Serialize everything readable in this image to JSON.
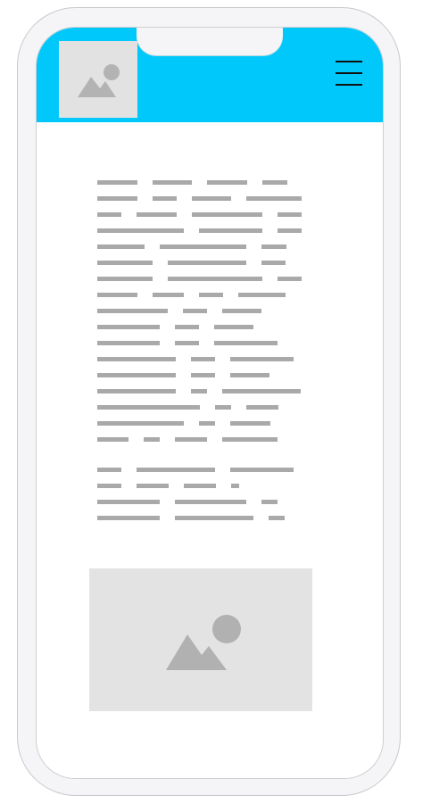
{
  "header": {
    "logo_icon": "image-placeholder-icon",
    "menu_icon": "hamburger-menu-icon",
    "background_color": "#00c8fa"
  },
  "content": {
    "paragraph_1_line_count": 17,
    "paragraph_2_line_count": 4
  },
  "media": {
    "image_icon": "image-placeholder-icon",
    "placeholder_color": "#e3e3e3"
  }
}
